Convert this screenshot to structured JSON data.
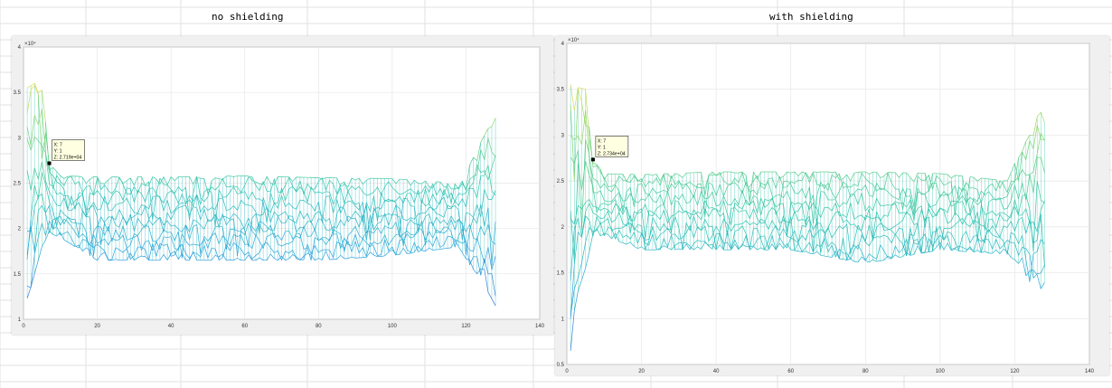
{
  "sheet": {
    "label_left": "no shielding",
    "label_right": "with shielding"
  },
  "chart_data": [
    {
      "type": "line",
      "subtype": "3d-mesh-side-view",
      "title": "",
      "xlabel": "",
      "ylabel": "",
      "xlim": [
        0,
        140
      ],
      "ylim": [
        1,
        4
      ],
      "y_exponent_label": "×10⁴",
      "xticks": [
        0,
        20,
        40,
        60,
        80,
        100,
        120,
        140
      ],
      "yticks": [
        1,
        1.5,
        2,
        2.5,
        3,
        3.5,
        4
      ],
      "ytick_labels": [
        "1",
        "1.5",
        "2",
        "2.5",
        "3",
        "3.5",
        "4"
      ],
      "grid": true,
      "colormap": [
        "#3f6fd8",
        "#2aa6dd",
        "#2cc4b0",
        "#6fd27a",
        "#e8e050"
      ],
      "series_profile": {
        "x": [
          1,
          3,
          5,
          7,
          10,
          20,
          40,
          60,
          80,
          100,
          118,
          121,
          124,
          126,
          128
        ],
        "top_envelope": [
          3.55,
          3.6,
          3.62,
          2.72,
          2.58,
          2.57,
          2.57,
          2.58,
          2.56,
          2.55,
          2.5,
          2.7,
          2.95,
          3.1,
          3.25
        ],
        "bottom_envelope": [
          1.2,
          1.5,
          1.8,
          1.95,
          1.9,
          1.65,
          1.65,
          1.65,
          1.65,
          1.7,
          1.8,
          1.6,
          1.45,
          1.3,
          1.15
        ]
      },
      "datatip": {
        "x": 7,
        "y": 1,
        "z": 27190,
        "lines": [
          "X: 7",
          "Y: 1",
          "Z: 2.719e+04"
        ]
      }
    },
    {
      "type": "line",
      "subtype": "3d-mesh-side-view",
      "title": "",
      "xlabel": "",
      "ylabel": "",
      "xlim": [
        0,
        140
      ],
      "ylim": [
        0.5,
        4
      ],
      "y_exponent_label": "×10⁴",
      "xticks": [
        0,
        20,
        40,
        60,
        80,
        100,
        120,
        140
      ],
      "yticks": [
        0.5,
        1,
        1.5,
        2,
        2.5,
        3,
        3.5,
        4
      ],
      "ytick_labels": [
        "0.5",
        "1",
        "1.5",
        "2",
        "2.5",
        "3",
        "3.5",
        "4"
      ],
      "grid": true,
      "colormap": [
        "#3f6fd8",
        "#2aa6dd",
        "#2cc4b0",
        "#6fd27a",
        "#e8e050"
      ],
      "series_profile": {
        "x": [
          1,
          3,
          5,
          7,
          10,
          20,
          40,
          60,
          80,
          100,
          118,
          121,
          124,
          126,
          128
        ],
        "top_envelope": [
          3.55,
          3.52,
          3.5,
          2.73,
          2.58,
          2.57,
          2.6,
          2.6,
          2.6,
          2.58,
          2.5,
          2.8,
          3.0,
          3.2,
          3.3
        ],
        "bottom_envelope": [
          0.65,
          1.3,
          1.55,
          1.9,
          1.9,
          1.75,
          1.75,
          1.75,
          1.6,
          1.75,
          1.7,
          1.6,
          1.4,
          1.3,
          1.35
        ]
      },
      "datatip": {
        "x": 7,
        "y": 1,
        "z": 27340,
        "lines": [
          "X: 7",
          "Y: 1",
          "Z: 2.734e+04"
        ]
      }
    }
  ]
}
